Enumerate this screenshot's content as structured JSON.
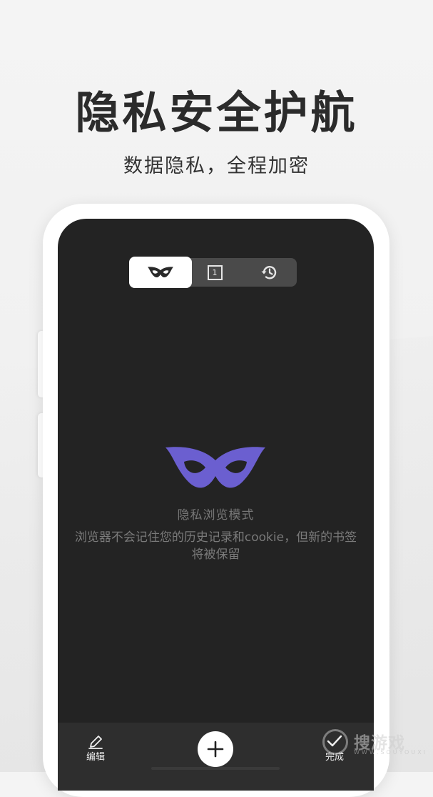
{
  "promo": {
    "headline": "隐私安全护航",
    "subline": "数据隐私，全程加密"
  },
  "segmented": {
    "items": [
      {
        "icon": "incognito-mask-icon",
        "selected": true
      },
      {
        "icon": "tab-count-icon",
        "count": "1",
        "selected": false
      },
      {
        "icon": "history-icon",
        "selected": false
      }
    ]
  },
  "incognito": {
    "title": "隐私浏览模式",
    "description": "浏览器不会记住您的历史记录和cookie，但新的书签将被保留"
  },
  "bottombar": {
    "edit_label": "编辑",
    "add_icon": "plus-icon",
    "done_label": "完成"
  },
  "watermark": {
    "text": "搜游戏",
    "url": "WWW.SOUYOUXI"
  },
  "colors": {
    "accent": "#6b5fd0",
    "screen_bg": "#232323",
    "bar_bg": "#2e2e2e"
  }
}
